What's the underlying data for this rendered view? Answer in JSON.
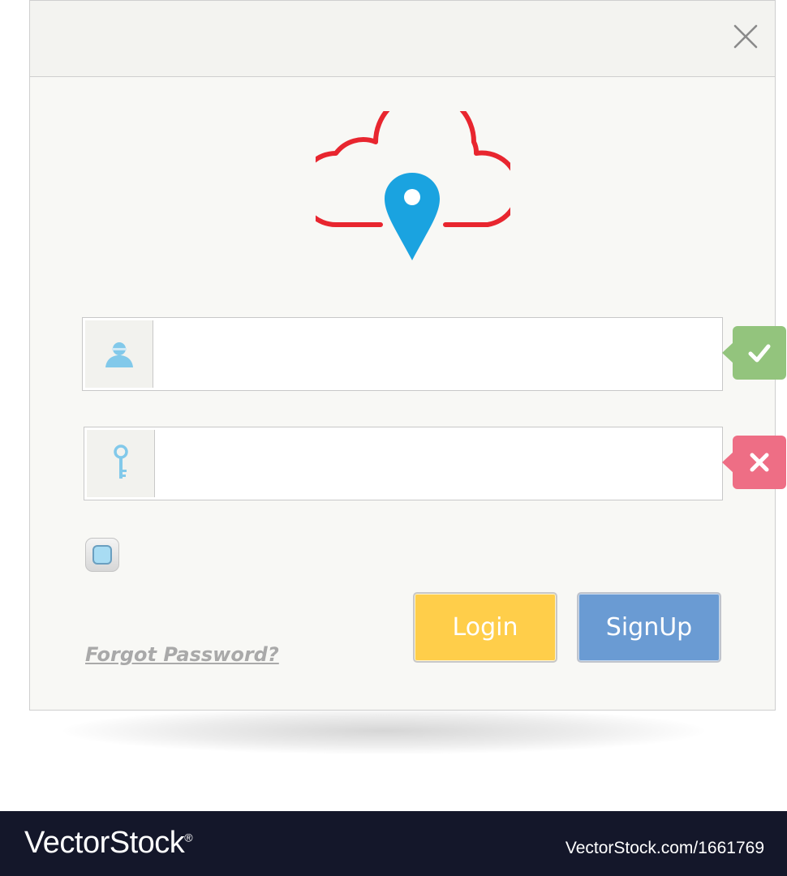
{
  "icons": {
    "close": "close-icon",
    "logo": "cloud-location-pin-icon",
    "user": "user-icon",
    "key": "key-icon",
    "valid": "checkmark-icon",
    "invalid": "cross-icon"
  },
  "colors": {
    "cloud": "#e8262f",
    "pin": "#1aa3e0",
    "field_icon": "#82c9ea",
    "badge_ok": "#93c47d",
    "badge_error": "#ee6e85",
    "login_button": "#ffce4a",
    "signup_button": "#6a9bd3",
    "footer_bg": "#14172a"
  },
  "form": {
    "username": {
      "value": "",
      "placeholder": ""
    },
    "password": {
      "value": "",
      "placeholder": ""
    },
    "remember_checked": true
  },
  "buttons": {
    "login_label": "Login",
    "signup_label": "SignUp"
  },
  "links": {
    "forgot_password": "Forgot Password?"
  },
  "watermark": {
    "brand": "VectorStock",
    "registered": "®",
    "url": "VectorStock.com/1661769"
  }
}
